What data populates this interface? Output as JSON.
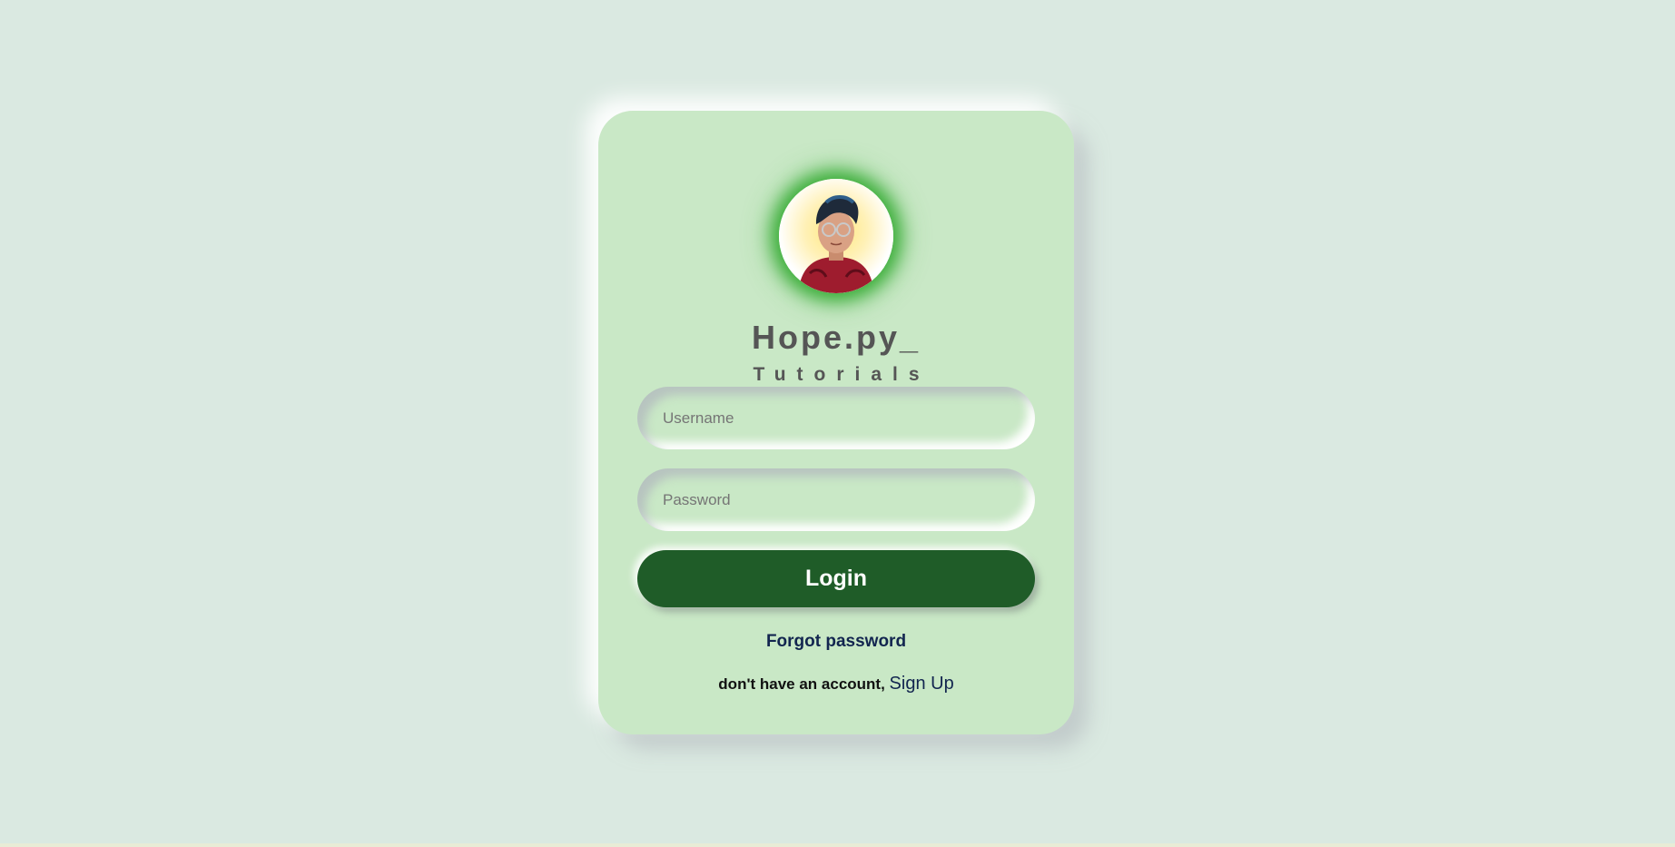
{
  "brand": {
    "title": "Hope.py_",
    "subtitle": "Tutorials"
  },
  "form": {
    "username_placeholder": "Username",
    "password_placeholder": "Password",
    "login_label": "Login",
    "forgot_label": "Forgot password",
    "signup_prompt": "don't have an account,",
    "signup_label": "Sign Up"
  },
  "colors": {
    "background": "#dae9e1",
    "card": "#c9e8c6",
    "login_button": "#1f5c28",
    "avatar_glow": "#3cae3a",
    "link": "#12254f"
  },
  "icons": {
    "avatar": "user-avatar-photo"
  }
}
